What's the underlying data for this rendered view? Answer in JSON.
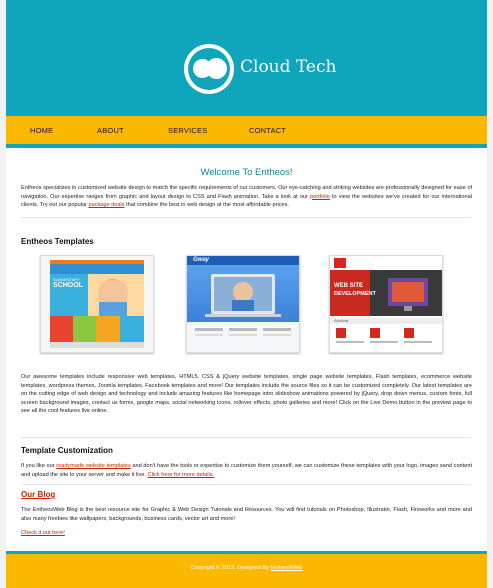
{
  "brand": {
    "name": "Cloud Tech"
  },
  "nav": [
    "HOME",
    "ABOUT",
    "SERVICES",
    "CONTACT"
  ],
  "welcome": {
    "title": "Welcome To Entheos!",
    "text1": "Entheos specializes in customized website design to match the specific requirements of our customers. Our eye-catching and striking websites are professionally designed for ease of navigation. Our expertise ranges from graphic and layout design to CSS and Flash animation. Take a look at our ",
    "link1": "portfolio",
    "text2": " to view the websites we've created for our international clients. Try out our popular ",
    "link2": "package deals",
    "text3": " that combine the best in web design at the most affordable prices."
  },
  "templates": {
    "title": "Entheos Templates",
    "thumb1": {
      "headline": "ELEMENTARY",
      "headline2": "SCHOOL"
    },
    "thumb2": {
      "brand": "Gway"
    },
    "thumb3": {
      "headline1": "WEB SITE",
      "headline2": "DEVELOPMENT",
      "tab": "Solutions"
    },
    "description": "Our awesome templates include responsive web templates, HTML5, CSS & jQuery website templates, single page website templates, Flash templates, ecommerce website templates, wordpress themes, Joomla templates, Facebook templates and more! Our templates include the source files so it can be customized completely. Our latest templates are on the cutting edge of web design and technology and include amazing features like homepage intro slideshow animations powered by jQuery, drop down menus, custom fonts, full screen background images, contact us forms, google maps, social networking icons, rollover effects, photo galleries and more! Click on the Live Demo button in the preview page to see all the cool features live online."
  },
  "customization": {
    "title": "Template Customization",
    "text1": "If you like our ",
    "link1": "readymade website templates",
    "text2": " and don't have the tools or expertise to customize them yourself, we can customize these templates with your logo, images sand content and upload the site to your server and make it live. ",
    "link2": "Click here for more details."
  },
  "blog": {
    "title": "Our Blog",
    "text": "The EntheosWeb Blog is the best resource site for Graphic & Web Design Tutorials and Resources. You will find tutorials on Photoshop, Illustrator, Flash, Fireworks and more and also many freebies like wallpapers, backgrounds, business cards, vector art and more!",
    "link": "Check it out here!"
  },
  "footer": {
    "text": "Copyright © 2013. Designed By ",
    "link": "EntheosWeb"
  },
  "colors": {
    "teal": "#0fa6bb",
    "yellow": "#fbb800",
    "link_red": "#cc2200"
  }
}
